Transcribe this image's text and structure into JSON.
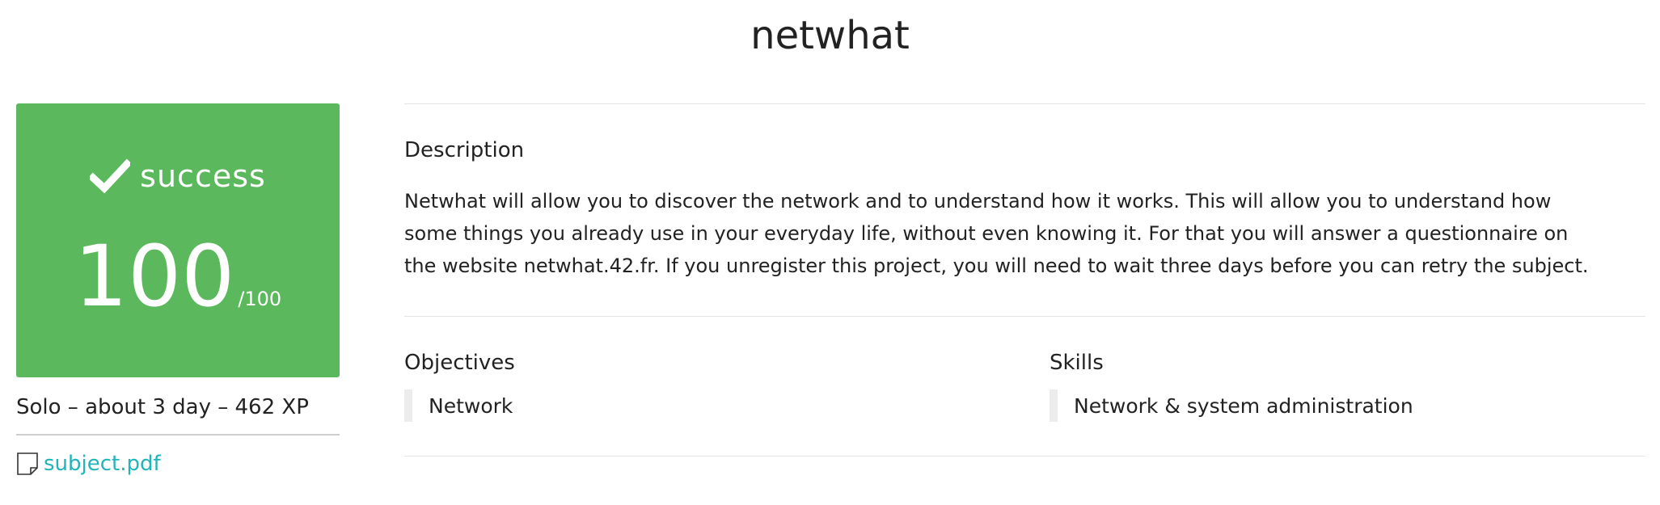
{
  "project": {
    "title": "netwhat"
  },
  "score_card": {
    "status": "success",
    "score": "100",
    "max": "/100",
    "color": "#5cb85c",
    "icon": "check-icon"
  },
  "meta": {
    "info": "Solo – about 3 day – 462 XP"
  },
  "attachment": {
    "label": "subject.pdf",
    "icon": "document-icon",
    "link_color": "#1fb5ba"
  },
  "description": {
    "label": "Description",
    "text": "Netwhat will allow you to discover the network and to understand how it works. This will allow you to understand how some things you already use in your everyday life, without even knowing it. For that you will answer a questionnaire on the website netwhat.42.fr. If you unregister this project, you will need to wait three days before you can retry the subject."
  },
  "objectives": {
    "label": "Objectives",
    "items": [
      "Network"
    ]
  },
  "skills": {
    "label": "Skills",
    "items": [
      "Network & system administration"
    ]
  }
}
